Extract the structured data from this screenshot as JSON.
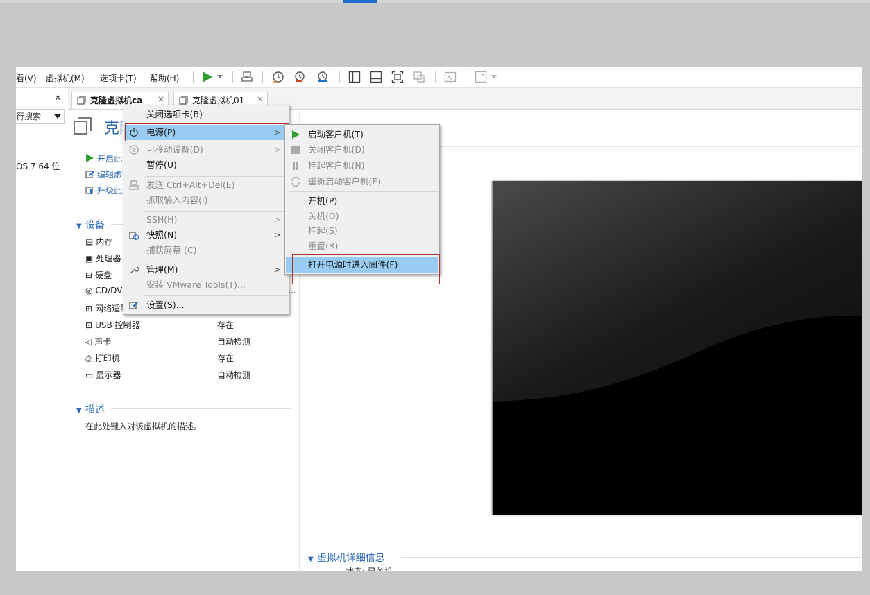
{
  "menubar": {
    "items": [
      {
        "label": "看(V)"
      },
      {
        "label": "虚拟机(M)"
      },
      {
        "label": "选项卡(T)"
      },
      {
        "label": "帮助(H)"
      }
    ]
  },
  "toolbar": {
    "icons": [
      "play-icon",
      "dropdown-caret-icon",
      "send-ctrl-alt-del-icon",
      "snapshot-icon",
      "revert-snapshot-icon",
      "manage-snapshot-icon",
      "library-view-icon",
      "thumbnail-bar-icon",
      "fullscreen-icon",
      "unity-icon",
      "console-icon",
      "stretch-icon"
    ]
  },
  "library": {
    "close_label": "×",
    "search_label": "行搜索",
    "tree_item": "OS 7 64 位"
  },
  "tabs": [
    {
      "label": "克隆虚拟机ca"
    },
    {
      "label": "克隆虚拟机01"
    }
  ],
  "vm": {
    "title": "克隆虚拟机ca",
    "actions": [
      "开启此虚拟机",
      "编辑虚拟机设置",
      "升级此虚拟机"
    ],
    "devices_header": "设备",
    "devices": [
      {
        "name": "内存",
        "value": ""
      },
      {
        "name": "处理器",
        "value": ""
      },
      {
        "name": "硬盘",
        "value": ""
      },
      {
        "name": "CD/DVD",
        "value": ""
      },
      {
        "name": "网络适配器",
        "value": ""
      },
      {
        "name": "USB 控制器",
        "value": "存在"
      },
      {
        "name": "声卡",
        "value": "自动检测"
      },
      {
        "name": "打印机",
        "value": "存在"
      },
      {
        "name": "显示器",
        "value": "自动检测"
      }
    ],
    "cdrom_trailing": "...",
    "desc_header": "描述",
    "desc_placeholder": "在此处键入对该虚拟机的描述。",
    "details_header": "虚拟机详细信息",
    "details_status": "状态: 已关机"
  },
  "context_menu": {
    "items": [
      {
        "label": "关闭选项卡(B)",
        "enabled": true
      },
      {
        "label": "电源(P)",
        "enabled": true,
        "submenu": true,
        "highlighted": true
      },
      {
        "label": "可移动设备(D)",
        "enabled": false,
        "submenu": true
      },
      {
        "label": "暂停(U)",
        "enabled": true
      },
      {
        "label": "发送 Ctrl+Alt+Del(E)",
        "enabled": false
      },
      {
        "label": "抓取输入内容(I)",
        "enabled": false
      },
      {
        "label": "SSH(H)",
        "enabled": false,
        "submenu": true
      },
      {
        "label": "快照(N)",
        "enabled": true,
        "submenu": true
      },
      {
        "label": "捕获屏幕 (C)",
        "enabled": false
      },
      {
        "label": "管理(M)",
        "enabled": true,
        "submenu": true
      },
      {
        "label": "安装 VMware Tools(T)...",
        "enabled": false
      },
      {
        "label": "设置(S)...",
        "enabled": true
      }
    ],
    "submenu_arrow": ">"
  },
  "power_submenu": {
    "items": [
      {
        "label": "启动客户机(T)",
        "enabled": true
      },
      {
        "label": "关闭客户机(D)",
        "enabled": false
      },
      {
        "label": "挂起客户机(N)",
        "enabled": false
      },
      {
        "label": "重新启动客户机(E)",
        "enabled": false
      },
      {
        "label": "开机(P)",
        "enabled": true
      },
      {
        "label": "关机(O)",
        "enabled": false
      },
      {
        "label": "挂起(S)",
        "enabled": false
      },
      {
        "label": "重置(R)",
        "enabled": false
      },
      {
        "label": "打开电源时进入固件(F)",
        "enabled": true,
        "highlighted": true
      }
    ]
  },
  "colors": {
    "accent": "#2d6ab3",
    "highlight": "#99ccf3",
    "annotation": "#b03030",
    "play_green": "#2e9e2e"
  }
}
